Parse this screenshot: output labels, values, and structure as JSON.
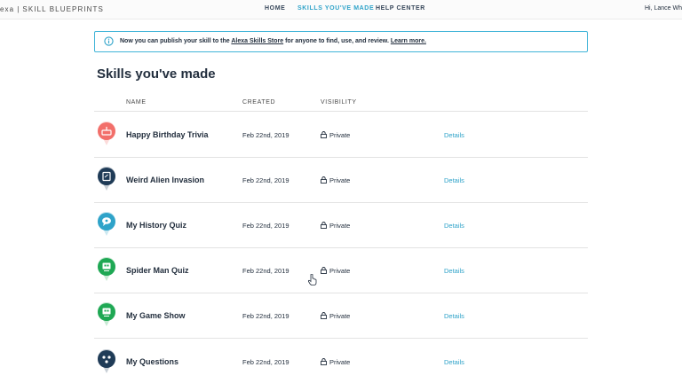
{
  "header": {
    "brand_left": "exa",
    "brand_right": "SKILL BLUEPRINTS",
    "nav": [
      {
        "label": "HOME",
        "active": false
      },
      {
        "label": "SKILLS YOU'VE MADE",
        "active": true
      },
      {
        "label": "HELP CENTER",
        "active": false
      }
    ],
    "greeting": "Hi, Lance Wh"
  },
  "banner": {
    "icon": "info-icon",
    "text_before": "Now you can publish your skill to the ",
    "link_text": "Alexa Skills Store",
    "text_middle": " for anyone to find, use, and review. ",
    "learn_more": "Learn more."
  },
  "page": {
    "title": "Skills you've made"
  },
  "table": {
    "columns": [
      "NAME",
      "CREATED",
      "VISIBILITY"
    ],
    "rows": [
      {
        "name": "Happy Birthday Trivia",
        "created": "Feb 22nd, 2019",
        "visibility": "Private",
        "action": "Details",
        "icon": "cake-icon",
        "icon_color": "#f26f6a"
      },
      {
        "name": "Weird Alien Invasion",
        "created": "Feb 22nd, 2019",
        "visibility": "Private",
        "action": "Details",
        "icon": "book-icon",
        "icon_color": "#1f3b57"
      },
      {
        "name": "My History Quiz",
        "created": "Feb 22nd, 2019",
        "visibility": "Private",
        "action": "Details",
        "icon": "speech-bubble-icon",
        "icon_color": "#2fa3c9"
      },
      {
        "name": "Spider Man Quiz",
        "created": "Feb 22nd, 2019",
        "visibility": "Private",
        "action": "Details",
        "icon": "quiz-icon",
        "icon_color": "#1fa854"
      },
      {
        "name": "My Game Show",
        "created": "Feb 22nd, 2019",
        "visibility": "Private",
        "action": "Details",
        "icon": "quiz-icon",
        "icon_color": "#1fa854"
      },
      {
        "name": "My Questions",
        "created": "Feb 22nd, 2019",
        "visibility": "Private",
        "action": "Details",
        "icon": "dots-icon",
        "icon_color": "#1f3b57"
      }
    ]
  },
  "colors": {
    "accent": "#2fa3c9",
    "text": "#232f3e",
    "banner_border": "#40b4d8"
  }
}
